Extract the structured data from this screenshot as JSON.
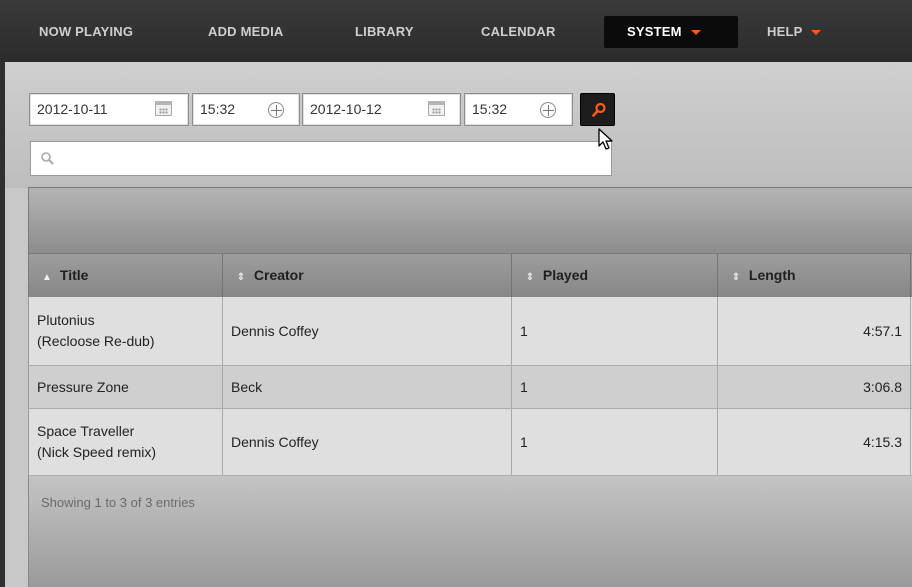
{
  "nav": {
    "items": [
      {
        "label": "NOW PLAYING"
      },
      {
        "label": "ADD MEDIA"
      },
      {
        "label": "LIBRARY"
      },
      {
        "label": "CALENDAR"
      },
      {
        "label": "SYSTEM",
        "active": true,
        "has_menu": true
      },
      {
        "label": "HELP",
        "has_menu": true
      }
    ],
    "accent_color": "#ff5d1a"
  },
  "filters": {
    "start_date": "2012-10-11",
    "start_time": "15:32",
    "end_date": "2012-10-12",
    "end_time": "15:32",
    "search_value": "",
    "search_icon": "magnifier-icon"
  },
  "table": {
    "columns": [
      {
        "label": "Title",
        "sort": "ascending"
      },
      {
        "label": "Creator",
        "sort": "none"
      },
      {
        "label": "Played",
        "sort": "none"
      },
      {
        "label": "Length",
        "sort": "none"
      }
    ],
    "rows": [
      {
        "title_line1": "Plutonius",
        "title_line2": "(Recloose Re-dub)",
        "creator": "Dennis Coffey",
        "played": "1",
        "length": "4:57.1"
      },
      {
        "title_line1": "Pressure Zone",
        "title_line2": "",
        "creator": "Beck",
        "played": "1",
        "length": "3:06.8"
      },
      {
        "title_line1": "Space Traveller",
        "title_line2": "(Nick Speed remix)",
        "creator": "Dennis Coffey",
        "played": "1",
        "length": "4:15.3"
      }
    ],
    "info": "Showing 1 to 3 of 3 entries"
  }
}
